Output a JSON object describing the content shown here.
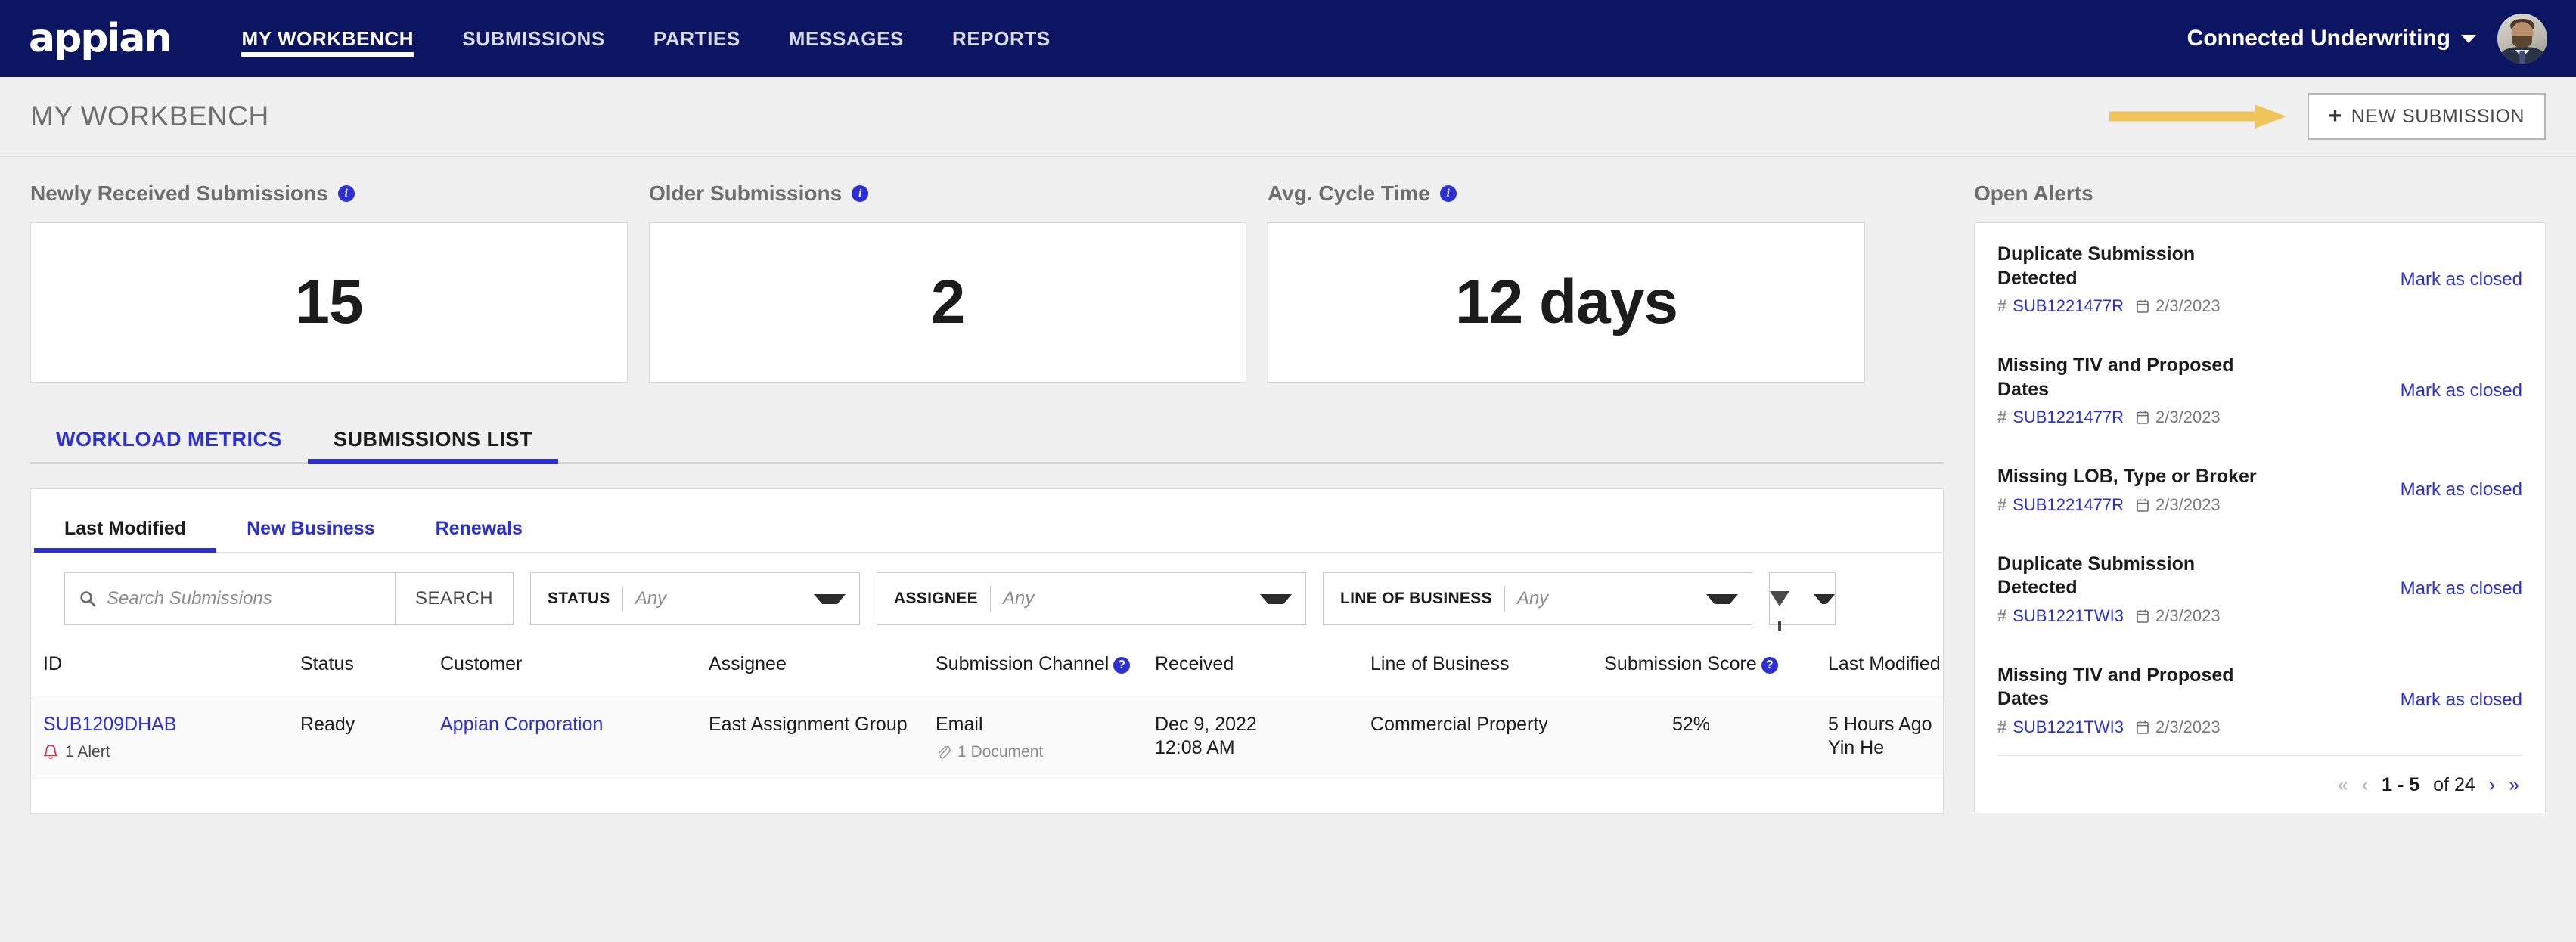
{
  "topnav": {
    "logo": "appian",
    "links": [
      {
        "label": "MY WORKBENCH",
        "active": true
      },
      {
        "label": "SUBMISSIONS",
        "active": false
      },
      {
        "label": "PARTIES",
        "active": false
      },
      {
        "label": "MESSAGES",
        "active": false
      },
      {
        "label": "REPORTS",
        "active": false
      }
    ],
    "org": "Connected Underwriting",
    "brand_color": "#0c1561"
  },
  "pagehead": {
    "title": "MY WORKBENCH",
    "new_submission_label": "NEW SUBMISSION",
    "plus": "+",
    "arrow_color": "#eec45b"
  },
  "kpis": [
    {
      "label": "Newly Received Submissions",
      "value": "15"
    },
    {
      "label": "Older Submissions",
      "value": "2"
    },
    {
      "label": "Avg. Cycle Time",
      "value": "12 days"
    }
  ],
  "tabs": [
    {
      "label": "WORKLOAD METRICS",
      "active": false
    },
    {
      "label": "SUBMISSIONS LIST",
      "active": true
    }
  ],
  "subtabs": [
    {
      "label": "Last Modified",
      "active": true
    },
    {
      "label": "New Business",
      "active": false
    },
    {
      "label": "Renewals",
      "active": false
    }
  ],
  "filters": {
    "search_placeholder": "Search Submissions",
    "search_value": "",
    "search_button": "SEARCH",
    "status": {
      "label": "STATUS",
      "value": "Any"
    },
    "assignee": {
      "label": "ASSIGNEE",
      "value": "Any"
    },
    "line_of_business": {
      "label": "LINE OF BUSINESS",
      "value": "Any"
    }
  },
  "table": {
    "columns": [
      "ID",
      "Status",
      "Customer",
      "Assignee",
      "Submission Channel",
      "Received",
      "Line of Business",
      "Submission Score",
      "Last Modified"
    ],
    "sort_column": "Last Modified",
    "sort_direction": "descending",
    "rows": [
      {
        "id": "SUB1209DHAB",
        "alerts": "1 Alert",
        "status": "Ready",
        "customer": "Appian Corporation",
        "assignee": "East Assignment Group",
        "channel": "Email",
        "documents": "1 Document",
        "received_date": "Dec 9, 2022",
        "received_time": "12:08 AM",
        "line_of_business": "Commercial Property",
        "score": "52%",
        "modified_when": "5 Hours Ago",
        "modified_by": "Yin He"
      }
    ]
  },
  "alerts_panel": {
    "title": "Open Alerts",
    "mark_closed_label": "Mark as closed",
    "items": [
      {
        "title": "Duplicate Submission Detected",
        "submission_id": "SUB1221477R",
        "date": "2/3/2023"
      },
      {
        "title": "Missing TIV and Proposed Dates",
        "submission_id": "SUB1221477R",
        "date": "2/3/2023"
      },
      {
        "title": "Missing LOB, Type or Broker",
        "submission_id": "SUB1221477R",
        "date": "2/3/2023"
      },
      {
        "title": "Duplicate Submission Detected",
        "submission_id": "SUB1221TWI3",
        "date": "2/3/2023"
      },
      {
        "title": "Missing TIV and Proposed Dates",
        "submission_id": "SUB1221TWI3",
        "date": "2/3/2023"
      }
    ],
    "pagination": {
      "first": "«",
      "prev": "‹",
      "range": "1 - 5",
      "of": "of 24",
      "next": "›",
      "last": "»"
    }
  }
}
